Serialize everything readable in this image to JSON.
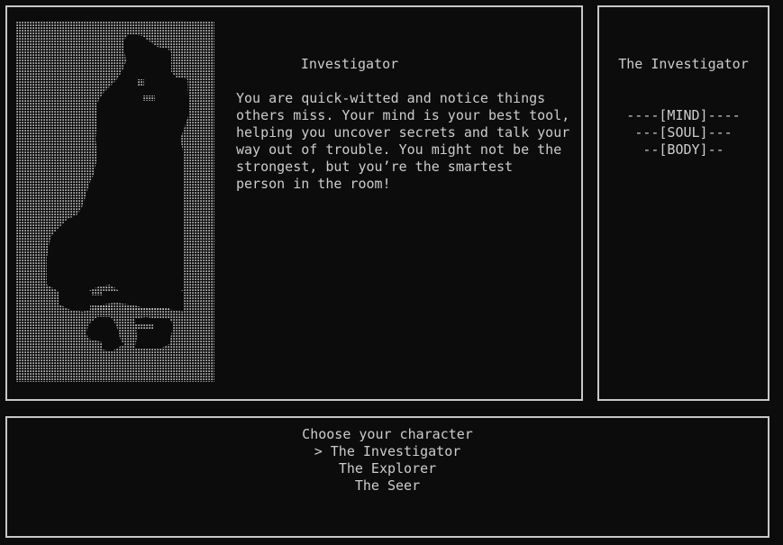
{
  "character_view": {
    "title": "Investigator",
    "description": "You are quick-witted and notice things\nothers miss. Your mind is your best tool,\nhelping you uncover secrets and talk your\nway out of trouble. You might not be the\nstrongest, but you’re the smartest\nperson in the room!"
  },
  "side_panel": {
    "title": "The Investigator",
    "stats": [
      "----[MIND]----",
      "---[SOUL]---",
      "--[BODY]--"
    ]
  },
  "menu": {
    "prompt": "Choose your character",
    "options": [
      "> The Investigator",
      "The Explorer",
      "The Seer"
    ],
    "selected_index": 0
  },
  "portrait": {
    "icon": "investigator-silhouette-ascii-art"
  }
}
